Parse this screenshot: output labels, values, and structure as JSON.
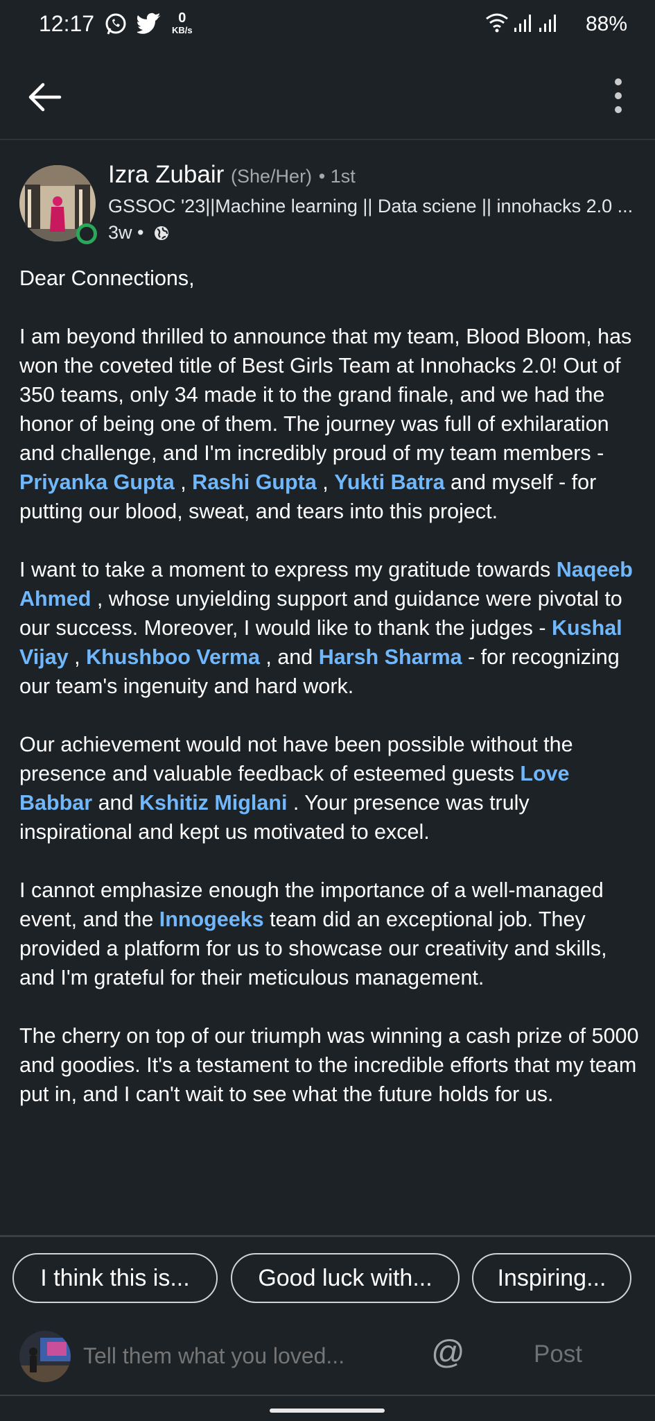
{
  "status_bar": {
    "time": "12:17",
    "net_speed_value": "0",
    "net_speed_unit": "KB/s",
    "battery": "88%",
    "icons": [
      "whatsapp-icon",
      "twitter-icon",
      "wifi-icon",
      "signal-icon",
      "signal-icon"
    ]
  },
  "app_bar": {
    "back_icon": "arrow-left-icon",
    "more_icon": "vertical-ellipsis-icon"
  },
  "author": {
    "name": "Izra Zubair",
    "pronouns": "(She/Her)",
    "degree": "• 1st",
    "headline": "GSSOC '23||Machine learning || Data sciene || innohacks 2.0 ...",
    "time": "3w •",
    "visibility_icon": "globe-icon"
  },
  "post": {
    "greeting": "Dear Connections,",
    "p1_a": "I am beyond thrilled to announce that my team, Blood Bloom, has won the coveted title of Best Girls Team at Innohacks 2.0! Out of 350 teams, only 34 made it to the grand finale, and we had the honor of being one of them. The journey was full of exhilaration and challenge, and I'm incredibly proud of my team members - ",
    "m_priyanka": "Priyanka Gupta",
    "sep1": " , ",
    "m_rashi": "Rashi Gupta",
    "sep2": " , ",
    "m_yukti": "Yukti Batra",
    "p1_b": " and  myself - for putting our blood, sweat, and tears into this project.",
    "p2_a": "I want to take a moment to express my gratitude towards ",
    "m_naqeeb": "Naqeeb Ahmed",
    "p2_b": " , whose unyielding support and guidance were pivotal to our success. Moreover, I would like to thank the judges - ",
    "m_kushal": "Kushal Vijay",
    "sep3": " , ",
    "m_khushboo": "Khushboo Verma",
    "sep4": " , and ",
    "m_harsh": "Harsh Sharma",
    "p2_c": " - for recognizing our team's ingenuity and hard work.",
    "p3_a": "Our achievement would not have been possible without the presence and valuable feedback of esteemed guests ",
    "m_love": "Love Babbar",
    "sep5": "  and ",
    "m_kshitiz": "Kshitiz Miglani",
    "p3_b": "  . Your presence was truly inspirational and kept us motivated to excel.",
    "p4_a": "I cannot emphasize enough the importance of a well-managed event, and the ",
    "m_innogeeks": "Innogeeks",
    "p4_b": " team did an exceptional job. They provided a platform for us to showcase our creativity and skills, and I'm grateful for their meticulous management.",
    "p5": "The cherry on top of our triumph was winning a cash prize of 5000 and goodies. It's a testament to the incredible efforts that my team put in, and I can't wait to see what the future holds for us.",
    "mention_color": "#71b7fb"
  },
  "suggestions": [
    "I think this is...",
    "Good luck with...",
    "Inspiring..."
  ],
  "comment_box": {
    "placeholder": "Tell them what you loved...",
    "mention_symbol": "@",
    "post_label": "Post"
  }
}
